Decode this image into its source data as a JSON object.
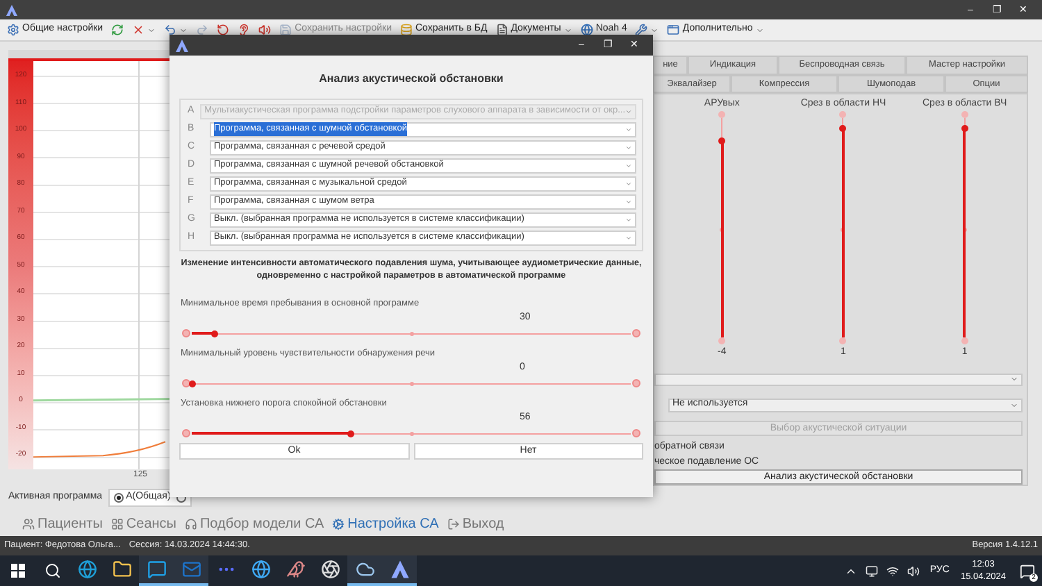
{
  "window": {
    "controls": [
      "–",
      "❐",
      "✕"
    ]
  },
  "toolbar": [
    {
      "kind": "settings",
      "label": "Общие настройки",
      "menu": false,
      "disabled": false
    },
    {
      "kind": "refresh",
      "menu": false,
      "disabled": false
    },
    {
      "kind": "cross",
      "menu": true,
      "disabled": false
    },
    {
      "kind": "undo",
      "menu": true,
      "disabled": false
    },
    {
      "kind": "redo",
      "menu": false,
      "disabled": true
    },
    {
      "kind": "reset",
      "menu": false,
      "disabled": false
    },
    {
      "kind": "ear",
      "menu": false,
      "disabled": false
    },
    {
      "kind": "sound",
      "menu": false,
      "disabled": false
    },
    {
      "kind": "save",
      "label": "Сохранить настройки",
      "menu": false,
      "disabled": true
    },
    {
      "kind": "database",
      "label": "Сохранить в БД",
      "menu": false,
      "disabled": false
    },
    {
      "kind": "documents",
      "label": "Документы",
      "menu": true,
      "disabled": false
    },
    {
      "kind": "noah",
      "label": "Noah 4",
      "menu": false,
      "disabled": false
    },
    {
      "kind": "tools",
      "menu": true,
      "disabled": false
    },
    {
      "kind": "window",
      "label": "Дополнительно",
      "menu": true,
      "disabled": false
    }
  ],
  "chart": {
    "yticks": [
      "120",
      "110",
      "100",
      "90",
      "80",
      "70",
      "60",
      "50",
      "40",
      "30",
      "20",
      "10",
      "0",
      "-10",
      "-20"
    ],
    "xticks": [
      "125"
    ]
  },
  "active_program": {
    "label": "Активная программа",
    "options": [
      {
        "label": "А(Общая)",
        "selected": true
      },
      {
        "selected": false
      }
    ]
  },
  "tabs_row_1": [
    {
      "label": "ние",
      "selected": false
    },
    {
      "label": "Индикация",
      "selected": false
    },
    {
      "label": "Беспроводная связь",
      "selected": false
    },
    {
      "label": "Мастер настройки",
      "selected": false
    }
  ],
  "tabs_row_2": [
    {
      "label": "Эквалайзер",
      "selected": false
    },
    {
      "label": "Компрессия",
      "selected": false
    },
    {
      "label": "Шумоподав",
      "selected": false
    },
    {
      "label": "Опции",
      "selected": false
    }
  ],
  "vertical_sliders": [
    {
      "label": "АРУвых",
      "level": 0.89,
      "reading": "-4"
    },
    {
      "label": "Срез в области НЧ",
      "level": 0.95,
      "reading": "1"
    },
    {
      "label": "Срез в области ВЧ",
      "level": 0.95,
      "reading": "1"
    }
  ],
  "panel": {
    "dropdown_2": {
      "value": "Не используется"
    },
    "situation_button": {
      "label": "Выбор акустической ситуации",
      "disabled": true
    },
    "line_1": "обратной связи",
    "line_2": "ческое подавление ОС",
    "analysis_button": {
      "label": "Анализ акустической обстановки"
    }
  },
  "nav": [
    {
      "kind": "patients",
      "label": "Пациенты",
      "selected": false
    },
    {
      "kind": "sessions",
      "label": "Сеансы",
      "selected": false
    },
    {
      "kind": "model",
      "label": "Подбор модели СА",
      "selected": false
    },
    {
      "kind": "fitting",
      "label": "Настройка СА",
      "selected": true
    },
    {
      "kind": "exit",
      "label": "Выход",
      "selected": false
    }
  ],
  "status_bar": {
    "patient": "Пациент: Федотова Ольга...",
    "session": "Сессия: 14.03.2024 14:44:30.",
    "version": "Версия 1.4.12.1"
  },
  "dialog": {
    "controls": [
      "–",
      "❐",
      "✕"
    ],
    "title": "Анализ акустической обстановки",
    "programs": [
      {
        "letter": "A",
        "value": "Мультиакустическая программа подстройки параметров слухового аппарата в зависимости от окр...",
        "disabled": true,
        "highlighted": false
      },
      {
        "letter": "B",
        "value": "Программа, связанная с шумной обстановкой",
        "disabled": false,
        "highlighted": true
      },
      {
        "letter": "C",
        "value": "Программа, связанная с речевой средой",
        "disabled": false,
        "highlighted": false
      },
      {
        "letter": "D",
        "value": "Программа, связанная с шумной речевой обстановкой",
        "disabled": false,
        "highlighted": false
      },
      {
        "letter": "E",
        "value": "Программа, связанная с музыкальной средой",
        "disabled": false,
        "highlighted": false
      },
      {
        "letter": "F",
        "value": "Программа, связанная с шумом ветра",
        "disabled": false,
        "highlighted": false
      },
      {
        "letter": "G",
        "value": "Выкл. (выбранная программа не используется в системе классификации)",
        "disabled": false,
        "highlighted": false
      },
      {
        "letter": "H",
        "value": "Выкл. (выбранная программа не используется в системе классификации)",
        "disabled": false,
        "highlighted": false
      }
    ],
    "note": "Изменение интенсивности автоматического подавления шума, учитывающее аудиометрические данные, одновременно с настройкой параметров в автоматической программе",
    "sliders": [
      {
        "label": "Минимальное время пребывания в основной программе",
        "reading": "30",
        "level": 0.05
      },
      {
        "label": "Минимальный уровень чувствительности обнаружения речи",
        "reading": "0",
        "level": 0.0
      },
      {
        "label": "Установка нижнего порога спокойной обстановки",
        "reading": "56",
        "level": 0.36
      }
    ],
    "buttons": [
      "Ok",
      "Нет"
    ]
  },
  "taskbar": {
    "apps": [
      {
        "kind": "edge",
        "running": false
      },
      {
        "kind": "folder",
        "running": false
      },
      {
        "kind": "skype",
        "running": true
      },
      {
        "kind": "outlook",
        "running": true
      },
      {
        "kind": "dots",
        "running": false
      },
      {
        "kind": "ie",
        "running": false
      },
      {
        "kind": "bird",
        "running": false
      },
      {
        "kind": "obs",
        "running": false
      },
      {
        "kind": "cloud",
        "running": true
      },
      {
        "kind": "app",
        "running": true
      }
    ],
    "language": "РУС",
    "time": "12:03",
    "date": "15.04.2024",
    "notifications": "2"
  }
}
